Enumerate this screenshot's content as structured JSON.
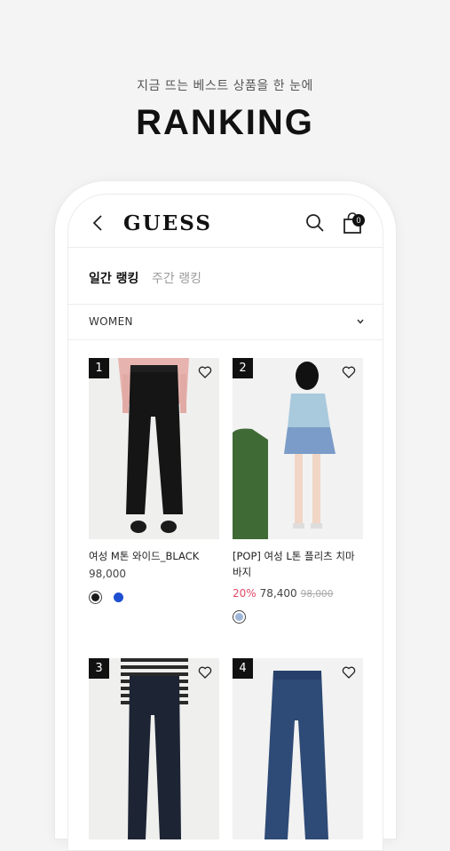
{
  "promo": {
    "subtitle": "지금 뜨는 베스트 상품을 한 눈에",
    "title": "RANKING"
  },
  "header": {
    "logo": "GUESS",
    "cart_count": "0",
    "icons": [
      "chevron-left-icon",
      "search-icon",
      "shopping-bag-icon"
    ]
  },
  "tabs": [
    {
      "label": "일간 랭킹",
      "active": true
    },
    {
      "label": "주간 랭킹",
      "active": false
    }
  ],
  "filter": {
    "selected": "WOMEN"
  },
  "products": [
    {
      "rank": "1",
      "name": "여성 M톤 와이드_BLACK",
      "price": "98,000",
      "discount": "",
      "original_price": "",
      "swatches": [
        "#1a1a1a",
        "#1f4fd1"
      ]
    },
    {
      "rank": "2",
      "name": "[POP] 여성 L톤 플리츠 치마바지",
      "price": "78,400",
      "discount": "20%",
      "original_price": "98,000",
      "swatches": [
        "#9fb6d8"
      ]
    },
    {
      "rank": "3",
      "name": "",
      "price": "",
      "discount": "",
      "original_price": "",
      "swatches": []
    },
    {
      "rank": "4",
      "name": "",
      "price": "",
      "discount": "",
      "original_price": "",
      "swatches": []
    }
  ]
}
